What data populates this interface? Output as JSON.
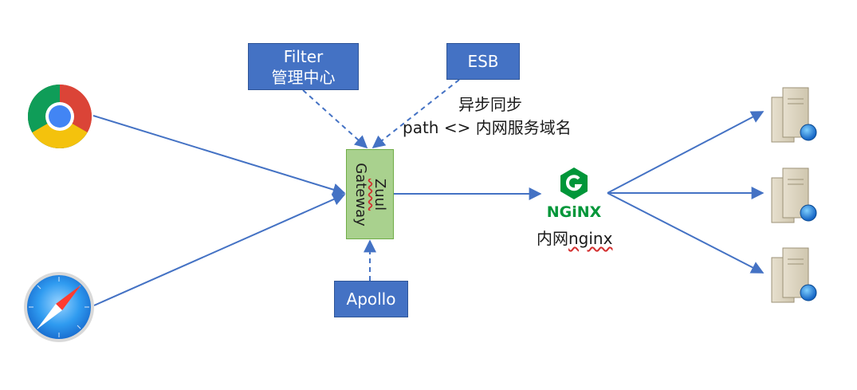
{
  "boxes": {
    "filter": {
      "line1": "Filter",
      "line2": "管理中心"
    },
    "esb": {
      "label": "ESB"
    },
    "apollo": {
      "label": "Apollo"
    },
    "gateway": {
      "line1": "Zuul",
      "line2": "Gateway"
    }
  },
  "labels": {
    "sync_line1": "异步同步",
    "sync_line2": "path <> 内网服务域名",
    "nginx_prefix": "内网",
    "nginx_suffix": "nginx",
    "nginx_logo": "NGiNX"
  },
  "icons": {
    "client_top": "chrome-browser-icon",
    "client_bottom": "safari-browser-icon",
    "servers": [
      "server-icon",
      "server-icon",
      "server-icon"
    ],
    "proxy": "nginx-logo-icon"
  },
  "colors": {
    "box_fill": "#4472c4",
    "gateway_fill": "#a9d18e",
    "arrow": "#4472c4",
    "nginx_green": "#009639"
  }
}
